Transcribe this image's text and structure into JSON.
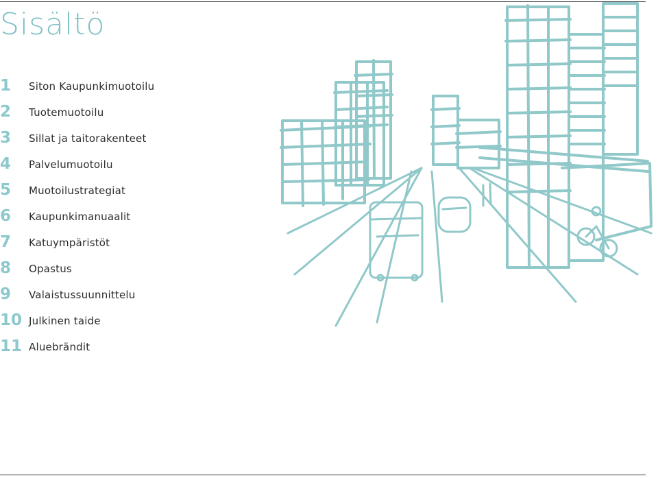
{
  "page": {
    "title": "Sisältö",
    "accent_color": "#8cc8cc"
  },
  "toc": [
    {
      "number": "1",
      "label": "Siton Kaupunkimuotoilu"
    },
    {
      "number": "2",
      "label": "Tuotemuotoilu"
    },
    {
      "number": "3",
      "label": "Sillat ja taitorakenteet"
    },
    {
      "number": "4",
      "label": "Palvelumuotoilu"
    },
    {
      "number": "5",
      "label": "Muotoilustrategiat"
    },
    {
      "number": "6",
      "label": "Kaupunkimanuaalit"
    },
    {
      "number": "7",
      "label": "Katuympäristöt"
    },
    {
      "number": "8",
      "label": "Opastus"
    },
    {
      "number": "9",
      "label": "Valaistussuunnittelu"
    },
    {
      "number": "10",
      "label": "Julkinen taide"
    },
    {
      "number": "11",
      "label": "Aluebrändit"
    }
  ],
  "illustration": {
    "icon": "city-street-sketch",
    "stroke_color": "#91c8c9"
  }
}
